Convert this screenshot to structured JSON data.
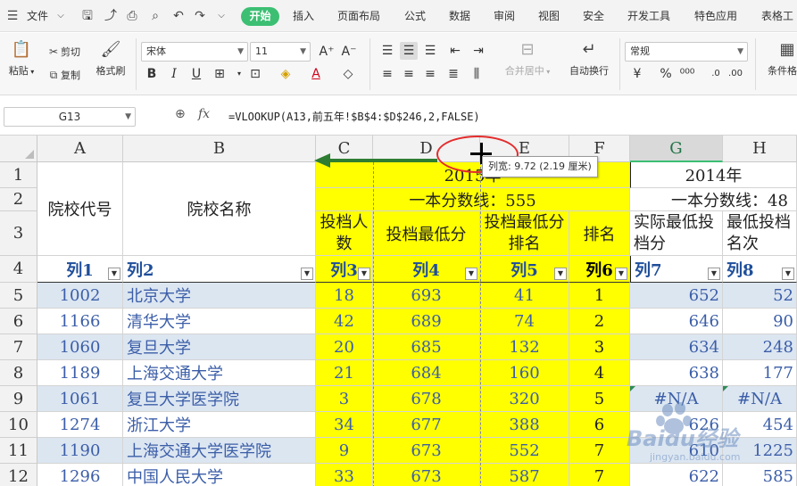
{
  "menubar": {
    "file_label": "文件",
    "tabs": [
      "开始",
      "插入",
      "页面布局",
      "公式",
      "数据",
      "审阅",
      "视图",
      "安全",
      "开发工具",
      "特色应用",
      "表格工"
    ],
    "active_tab": "开始"
  },
  "ribbon": {
    "paste_label": "粘贴",
    "cut_label": "剪切",
    "copy_label": "复制",
    "format_painter_label": "格式刷",
    "font_name": "宋体",
    "font_size": "11",
    "merge_center_label": "合并居中",
    "wrap_text_label": "自动换行",
    "number_format": "常规",
    "conditional_format_label": "条件格式"
  },
  "formula_bar": {
    "name_box": "G13",
    "fx": "fx",
    "formula": "=VLOOKUP(A13,前五年!$B$4:$D$246,2,FALSE)"
  },
  "columns": [
    "A",
    "B",
    "C",
    "D",
    "E",
    "F",
    "G",
    "H"
  ],
  "row_numbers": [
    "1",
    "2",
    "3",
    "4",
    "5",
    "6",
    "7",
    "8",
    "9",
    "10",
    "11",
    "12"
  ],
  "header": {
    "school_code": "院校代号",
    "school_name": "院校名称",
    "year_2015": "2015年",
    "year_2014": "2014年",
    "cutoff_2015": "一本分数线：555",
    "cutoff_2014": "一本分数线：48",
    "c3": "投档人数",
    "d3": "投档最低分",
    "e3": "投档最低分排名",
    "f3": "排名",
    "g3": "实际最低投档分",
    "h3": "最低投档名次"
  },
  "filter_row": [
    "列1",
    "列2",
    "列3",
    "列4",
    "列5",
    "列6",
    "列7",
    "列8"
  ],
  "rows": [
    {
      "code": "1002",
      "name": "北京大学",
      "c": "18",
      "d": "693",
      "e": "41",
      "f": "1",
      "g": "652",
      "h": "52"
    },
    {
      "code": "1166",
      "name": "清华大学",
      "c": "42",
      "d": "689",
      "e": "74",
      "f": "2",
      "g": "646",
      "h": "90"
    },
    {
      "code": "1060",
      "name": "复旦大学",
      "c": "20",
      "d": "685",
      "e": "132",
      "f": "3",
      "g": "634",
      "h": "248"
    },
    {
      "code": "1189",
      "name": "上海交通大学",
      "c": "21",
      "d": "684",
      "e": "160",
      "f": "4",
      "g": "638",
      "h": "177"
    },
    {
      "code": "1061",
      "name": "复旦大学医学院",
      "c": "3",
      "d": "678",
      "e": "320",
      "f": "5",
      "g": "#N/A",
      "h": "#N/A"
    },
    {
      "code": "1274",
      "name": "浙江大学",
      "c": "34",
      "d": "677",
      "e": "388",
      "f": "6",
      "g": "626",
      "h": "454"
    },
    {
      "code": "1190",
      "name": "上海交通大学医学院",
      "c": "9",
      "d": "673",
      "e": "552",
      "f": "7",
      "g": "610",
      "h": "1225"
    },
    {
      "code": "1296",
      "name": "中国人民大学",
      "c": "33",
      "d": "673",
      "e": "587",
      "f": "7",
      "g": "622",
      "h": "585"
    }
  ],
  "tooltip": "列宽: 9.72 (2.19 厘米)",
  "watermark": {
    "brand": "Baidu经验",
    "url": "jingyan.baidu.com"
  },
  "colors": {
    "accent_green": "#3cbf73",
    "highlight_yellow": "#ffff00",
    "band_blue": "#dce6f1",
    "annotation_red": "#e32c2c",
    "arrow_green": "#2e7d32"
  }
}
